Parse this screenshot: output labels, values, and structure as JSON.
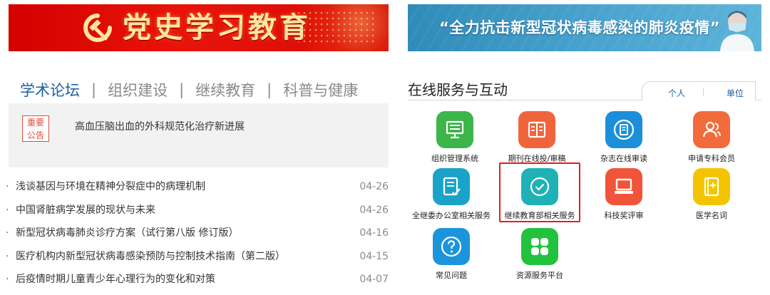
{
  "banners": {
    "left_title": "党史学习教育",
    "right_title": "“全力抗击新型冠状病毒感染的肺炎疫情”"
  },
  "tabs": [
    {
      "label": "学术论坛",
      "active": true
    },
    {
      "label": "组织建设",
      "active": false
    },
    {
      "label": "继续教育",
      "active": false
    },
    {
      "label": "科普与健康",
      "active": false
    }
  ],
  "tab_separator": "|",
  "notice": {
    "badge_line1": "重要",
    "badge_line2": "公告",
    "headline": "高血压脑出血的外科规范化治疗新进展"
  },
  "news": [
    {
      "bullet": "·",
      "title": "浅谈基因与环境在精神分裂症中的病理机制",
      "date": "04-26"
    },
    {
      "bullet": "·",
      "title": "中国肾脏病学发展的现状与未来",
      "date": "04-26"
    },
    {
      "bullet": "·",
      "title": "新型冠状病毒肺炎诊疗方案（试行第八版 修订版）",
      "date": "04-16"
    },
    {
      "bullet": "·",
      "title": "医疗机构内新型冠状病毒感染预防与控制技术指南（第二版）",
      "date": "04-15"
    },
    {
      "bullet": "·",
      "title": "后疫情时期儿童青少年心理行为的变化和对策",
      "date": "04-07"
    }
  ],
  "services": {
    "title": "在线服务与互动",
    "toggle": [
      "个人",
      "单位"
    ],
    "items": [
      {
        "label": "组织管理系统",
        "icon": "monitor-icon",
        "color": "#3cb54a"
      },
      {
        "label": "期刊在线投/审稿",
        "icon": "book-icon",
        "color": "#f0643c"
      },
      {
        "label": "杂志在线审读",
        "icon": "document-icon",
        "color": "#1b8fd9"
      },
      {
        "label": "申请专科会员",
        "icon": "user-group-icon",
        "color": "#f36b3a"
      },
      {
        "label": "全继委办公室相关服务",
        "icon": "edit-doc-icon",
        "color": "#1aa3c9"
      },
      {
        "label": "继续教育部相关服务",
        "icon": "check-circle-icon",
        "color": "#1fb1b6"
      },
      {
        "label": "科技奖评审",
        "icon": "laptop-icon",
        "color": "#f2543a"
      },
      {
        "label": "医学名词",
        "icon": "medical-book-icon",
        "color": "#f5c400"
      },
      {
        "label": "常见问题",
        "icon": "question-icon",
        "color": "#1b94dc"
      },
      {
        "label": "资源服务平台",
        "icon": "clover-icon",
        "color": "#22c23e"
      }
    ]
  },
  "colors": {
    "accent_blue": "#1a5f9e",
    "highlight_red": "#e0201b",
    "party_red": "#d40000"
  }
}
